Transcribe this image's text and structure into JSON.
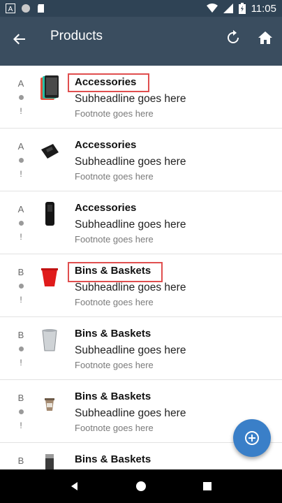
{
  "status_bar": {
    "time": "11:05",
    "left_icons": [
      "a-icon",
      "circle-icon",
      "sd-card-icon"
    ],
    "right_icons": [
      "wifi-icon",
      "signal-icon",
      "battery-icon"
    ]
  },
  "app_bar": {
    "title": "Products",
    "back_icon": "back-arrow-icon",
    "refresh_icon": "refresh-icon",
    "home_icon": "home-icon",
    "background": "#3a4d5f"
  },
  "items": [
    {
      "status_letter": "A",
      "title": "Accessories",
      "subheadline": "Subheadline goes here",
      "footnote": "Footnote goes here",
      "thumb": "tablet-icon"
    },
    {
      "status_letter": "A",
      "title": "Accessories",
      "subheadline": "Subheadline goes here",
      "footnote": "Footnote goes here",
      "thumb": "case-icon"
    },
    {
      "status_letter": "A",
      "title": "Accessories",
      "subheadline": "Subheadline goes here",
      "footnote": "Footnote goes here",
      "thumb": "holster-icon"
    },
    {
      "status_letter": "B",
      "title": "Bins & Baskets",
      "subheadline": "Subheadline goes here",
      "footnote": "Footnote goes here",
      "thumb": "red-bin-icon"
    },
    {
      "status_letter": "B",
      "title": "Bins & Baskets",
      "subheadline": "Subheadline goes here",
      "footnote": "Footnote goes here",
      "thumb": "wastebasket-icon"
    },
    {
      "status_letter": "B",
      "title": "Bins & Baskets",
      "subheadline": "Subheadline goes here",
      "footnote": "Footnote goes here",
      "thumb": "cup-icon"
    },
    {
      "status_letter": "B",
      "title": "Bins & Baskets",
      "subheadline": "",
      "footnote": "",
      "thumb": "canister-icon"
    }
  ],
  "status_bang": "!",
  "fab": {
    "icon": "add-circle-icon",
    "color": "#3a7fc8"
  },
  "highlight_color": "#e04e4e",
  "nav_bar": {
    "icons": [
      "back-triangle-icon",
      "home-circle-icon",
      "recents-square-icon"
    ]
  }
}
